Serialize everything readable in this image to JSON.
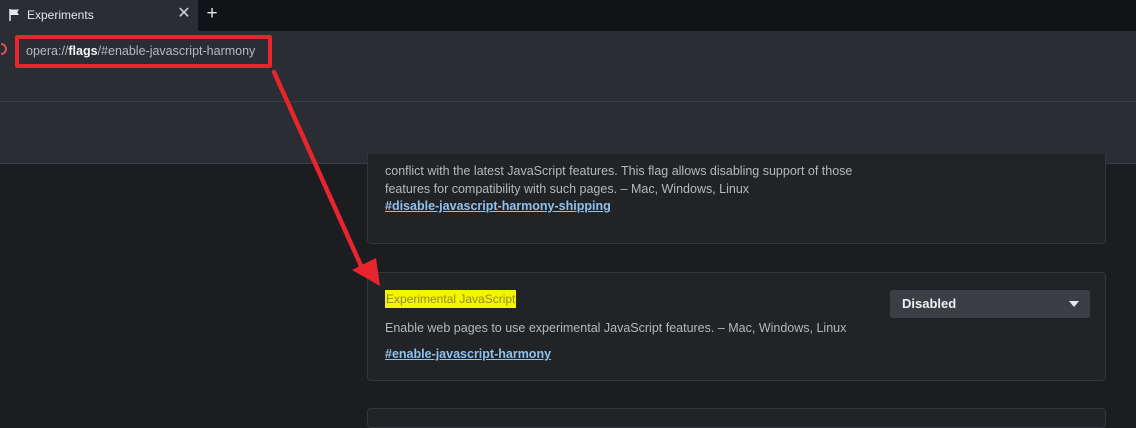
{
  "tab": {
    "title": "Experiments",
    "close_glyph": "✕",
    "new_tab_glyph": "+",
    "icon": "flag-icon"
  },
  "address": {
    "prefix": "opera://",
    "host": "flags",
    "path": "/#enable-javascript-harmony",
    "site_icon": "opera-icon"
  },
  "flags": [
    {
      "description": "conflict with the latest JavaScript features. This flag allows disabling support of those features for compatibility with such pages. – Mac, Windows, Linux",
      "anchor": "#disable-javascript-harmony-shipping"
    },
    {
      "title": "Experimental JavaScript",
      "description": "Enable web pages to use experimental JavaScript features. – Mac, Windows, Linux",
      "anchor": "#enable-javascript-harmony",
      "select_value": "Disabled"
    }
  ],
  "annotation": {
    "highlight_color": "#e8242c",
    "title_highlight_color": "#f5f500"
  }
}
